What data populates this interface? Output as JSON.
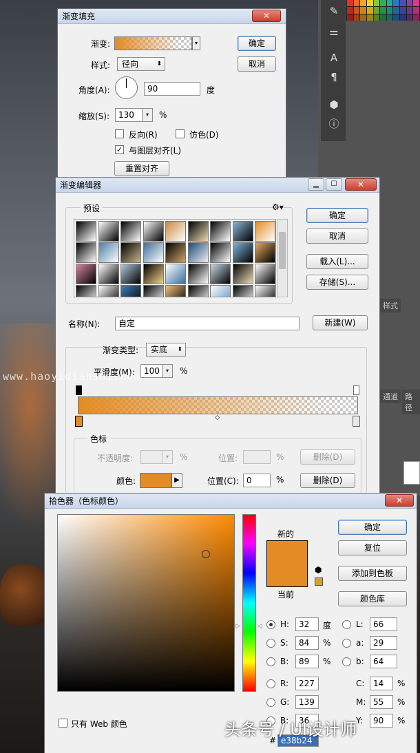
{
  "gradient_fill": {
    "title": "渐变填充",
    "close": "✕",
    "gradient_label": "渐变:",
    "style_label": "样式:",
    "style_value": "径向",
    "angle_label": "角度(A):",
    "angle_value": "90",
    "angle_unit": "度",
    "scale_label": "缩放(S):",
    "scale_value": "130",
    "percent": "%",
    "reverse_label": "反向(R)",
    "dither_label": "仿色(D)",
    "align_label": "与图层对齐(L)",
    "reset_align": "重置对齐",
    "ok": "确定",
    "cancel": "取消"
  },
  "gradient_editor": {
    "title": "渐变编辑器",
    "presets_label": "预设",
    "ok": "确定",
    "cancel": "取消",
    "load": "载入(L)...",
    "save": "存储(S)...",
    "name_label": "名称(N):",
    "name_value": "自定",
    "new": "新建(W)",
    "type_label": "渐变类型:",
    "type_value": "实底",
    "smooth_label": "平滑度(M):",
    "smooth_value": "100",
    "percent": "%",
    "stops_label": "色标",
    "opacity_label": "不透明度:",
    "position_label": "位置:",
    "delete": "删除(D)",
    "color_label": "颜色:",
    "position_c_label": "位置(C):",
    "position_c_value": "0",
    "delete2": "删除(D)"
  },
  "color_picker": {
    "title": "拾色器（色标颜色）",
    "close": "✕",
    "ok": "确定",
    "reset": "复位",
    "add_swatch": "添加到色板",
    "color_libraries": "颜色库",
    "new_label": "新的",
    "current_label": "当前",
    "web_only": "只有 Web 颜色",
    "H": {
      "label": "H:",
      "value": "32",
      "unit": "度"
    },
    "S": {
      "label": "S:",
      "value": "84",
      "unit": "%"
    },
    "Bv": {
      "label": "B:",
      "value": "89",
      "unit": "%"
    },
    "R": {
      "label": "R:",
      "value": "227"
    },
    "G": {
      "label": "G:",
      "value": "139"
    },
    "B2": {
      "label": "B:",
      "value": "36"
    },
    "L": {
      "label": "L:",
      "value": "66"
    },
    "a": {
      "label": "a:",
      "value": "29"
    },
    "b": {
      "label": "b:",
      "value": "64"
    },
    "C": {
      "label": "C:",
      "value": "14",
      "unit": "%"
    },
    "M": {
      "label": "M:",
      "value": "55",
      "unit": "%"
    },
    "Y": {
      "label": "Y:",
      "value": "90",
      "unit": "%"
    },
    "hash": "#",
    "hex": "e38b24"
  },
  "panels": {
    "style_tab": "样式",
    "channels_tab": "通道",
    "paths_tab": "路径"
  },
  "watermark": "www.haoyidianshi.com",
  "credit": "头条号 / UI设计师",
  "colors": {
    "accent_orange": "#e38b24",
    "dialog_bg": "#f0f0f0",
    "title_bar": "#c8d6ea",
    "close_red": "#c9402f"
  },
  "icons": [
    "brush-icon",
    "adjust-icon",
    "text-icon",
    "paragraph-icon",
    "cube-icon",
    "info-icon",
    "gear-icon",
    "triangle-right-icon",
    "gamut-cube-icon"
  ]
}
